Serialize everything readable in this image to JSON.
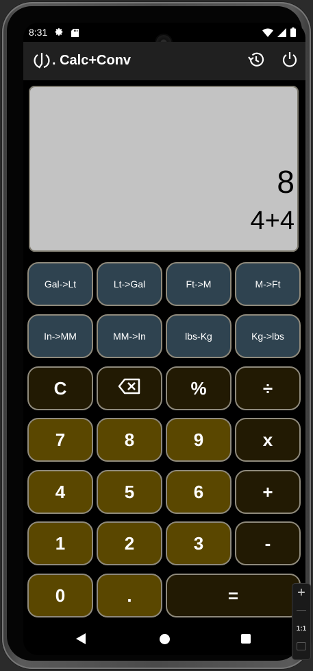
{
  "status_bar": {
    "time": "8:31"
  },
  "app_bar": {
    "title": ". Calc+Conv"
  },
  "display": {
    "result": "8",
    "expression": "4+4"
  },
  "converter_buttons": [
    {
      "label": "Gal->Lt"
    },
    {
      "label": "Lt->Gal"
    },
    {
      "label": "Ft->M"
    },
    {
      "label": "M->Ft"
    },
    {
      "label": "In->MM"
    },
    {
      "label": "MM->In"
    },
    {
      "label": "lbs-Kg"
    },
    {
      "label": "Kg->lbs"
    }
  ],
  "keys": {
    "clear": "C",
    "percent": "%",
    "divide": "÷",
    "multiply": "x",
    "add": "+",
    "subtract": "-",
    "equals": "=",
    "decimal": ".",
    "seven": "7",
    "eight": "8",
    "nine": "9",
    "four": "4",
    "five": "5",
    "six": "6",
    "one": "1",
    "two": "2",
    "three": "3",
    "zero": "0"
  },
  "emulator_controls": {
    "plus": "+",
    "ratio": "1:1"
  },
  "colors": {
    "display_bg": "#c3c3c3",
    "converter_bg": "#2f4350",
    "number_bg": "#5a4700",
    "operator_bg": "#221a03",
    "app_bar_bg": "#202020"
  }
}
